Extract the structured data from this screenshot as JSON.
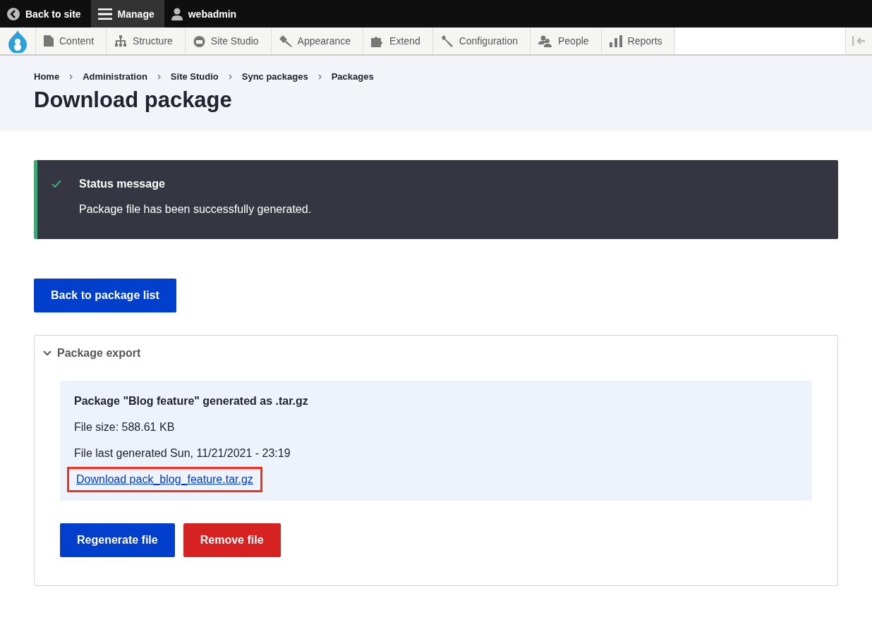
{
  "toolbar": {
    "back": "Back to site",
    "manage": {
      "label": "Manage",
      "selected": true
    },
    "user": "webadmin"
  },
  "menu": [
    "Content",
    "Structure",
    "Site Studio",
    "Appearance",
    "Extend",
    "Configuration",
    "People",
    "Reports"
  ],
  "breadcrumb": [
    "Home",
    "Administration",
    "Site Studio",
    "Sync packages",
    "Packages"
  ],
  "title": "Download package",
  "status": {
    "title": "Status message",
    "text": "Package file has been successfully generated."
  },
  "back_button": "Back to package list",
  "details": {
    "summary": "Package export",
    "expanded": true,
    "heading": "Package \"Blog feature\" generated as .tar.gz",
    "size": "File size: 588.61 KB",
    "generated": "File last generated Sun, 11/21/2021 - 23:19",
    "link": {
      "label": "Download pack_blog_feature.tar.gz",
      "highlighted": true
    },
    "buttons": [
      {
        "label": "Regenerate file",
        "kind": "primary"
      },
      {
        "label": "Remove file",
        "kind": "danger"
      }
    ]
  }
}
